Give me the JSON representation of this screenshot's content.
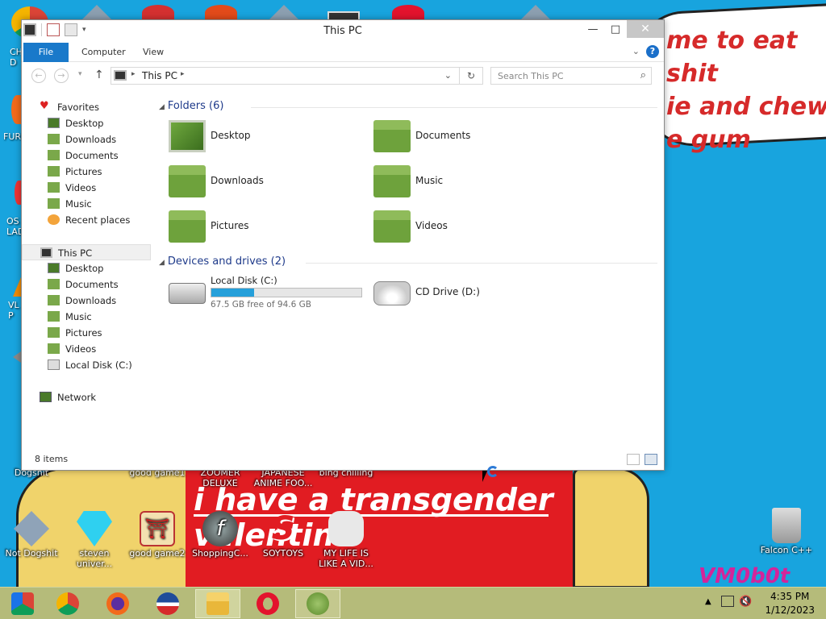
{
  "desktop": {
    "speech_text": "me to eat shit\nie and chew\ne gum",
    "banner_text": "i have a transgender\nvalentine",
    "watermark": "VM0b0t",
    "left_labels": [
      "CH\nD",
      "FUR",
      "OS\nLAD",
      "VL\nP"
    ],
    "icons": [
      {
        "label": "Dogshit"
      },
      {
        "label": "good game1"
      },
      {
        "label": "ZOOMER DELUXE"
      },
      {
        "label": "JAPANESE ANIME FOO..."
      },
      {
        "label": "bing chilling"
      },
      {
        "label": "Not Dogshit"
      },
      {
        "label": "steven univer..."
      },
      {
        "label": "good game2"
      },
      {
        "label": "ShoppingC..."
      },
      {
        "label": "SOYTOYS"
      },
      {
        "label": "MY LIFE IS LIKE A VID..."
      },
      {
        "label": "Falcon C++"
      }
    ]
  },
  "taskbar": {
    "items": [
      "start-icon",
      "chrome-icon",
      "firefox-icon",
      "obama-icon",
      "file-explorer-icon",
      "opera-icon",
      "messenger-icon"
    ],
    "time": "4:35 PM",
    "date": "1/12/2023"
  },
  "window": {
    "title": "This PC",
    "ribbon_tabs": [
      "File",
      "Computer",
      "View"
    ],
    "address": "This PC",
    "search_placeholder": "Search This PC",
    "nav": {
      "favorites": "Favorites",
      "fav_items": [
        "Desktop",
        "Downloads",
        "Documents",
        "Pictures",
        "Videos",
        "Music",
        "Recent places"
      ],
      "this_pc": "This PC",
      "pc_items": [
        "Desktop",
        "Documents",
        "Downloads",
        "Music",
        "Pictures",
        "Videos",
        "Local Disk (C:)"
      ],
      "network": "Network"
    },
    "folders_header": "Folders (6)",
    "folders": [
      "Desktop",
      "Documents",
      "Downloads",
      "Music",
      "Pictures",
      "Videos"
    ],
    "devices_header": "Devices and drives (2)",
    "local_disk": {
      "name": "Local Disk (C:)",
      "free_text": "67.5 GB free of 94.6 GB",
      "used_fraction": 0.2865
    },
    "cd_drive": "CD Drive (D:)",
    "status": "8 items"
  },
  "colors": {
    "accent": "#1979ca",
    "folder": "#6ea23c",
    "wallpaper": "#18a4de",
    "taskbar": "#b5bb7a"
  }
}
